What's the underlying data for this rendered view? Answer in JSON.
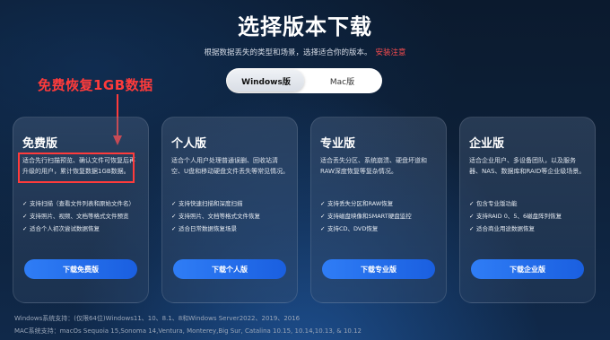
{
  "header": {
    "title": "选择版本下载",
    "subtitle": "根据数据丢失的类型和场景，选择适合你的版本。",
    "note": "安装注意"
  },
  "os_toggle": {
    "options": [
      "Windows版",
      "Mac版"
    ],
    "selected": "Windows版"
  },
  "callout": {
    "text": "免费恢复1GB数据",
    "color": "#ff3b3b"
  },
  "cards": [
    {
      "title": "免费版",
      "description": "适合先行扫描预览、确认文件可恢复后再升级的用户，累计恢复数据1GB数据。",
      "features": [
        "支持扫描（查看文件列表和原始文件名）",
        "支持照片、视频、文档等格式文件预览",
        "适合个人初次尝试数据恢复"
      ],
      "button": "下载免费版"
    },
    {
      "title": "个人版",
      "description": "适合个人用户处理普通误删、回收站清空、U盘和移动硬盘文件丢失等常见情况。",
      "features": [
        "支持快速扫描和深度扫描",
        "支持照片、文档等格式文件恢复",
        "适合日常数据恢复场景"
      ],
      "button": "下载个人版"
    },
    {
      "title": "专业版",
      "description": "适合丢失分区、系统崩溃、硬盘坏道和RAW深度恢复等复杂情况。",
      "features": [
        "支持丢失分区和RAW恢复",
        "支持磁盘映像和SMART硬盘监控",
        "支持CD、DVD恢复"
      ],
      "button": "下载专业版"
    },
    {
      "title": "企业版",
      "description": "适合企业用户、多设备团队，以及服务器、NAS、数据库和RAID等企业级场景。",
      "features": [
        "包含专业版功能",
        "支持RAID 0、5、6磁盘阵列恢复",
        "适合商业用途数据恢复"
      ],
      "button": "下载企业版"
    }
  ],
  "system_support": {
    "windows": "Windows系统支持：(仅限64位)Windows11、10、8.1、8和Windows Server2022、2019、2016",
    "mac": "MAC系统支持：macOs Sequoia 15,Sonoma 14,Ventura, Monterey,Big Sur, Catalina 10.15, 10.14,10.13, & 10.12"
  },
  "colors": {
    "accent_button": "#2f7df6",
    "highlight": "#ff3b3b",
    "note": "#ff4d4f"
  }
}
